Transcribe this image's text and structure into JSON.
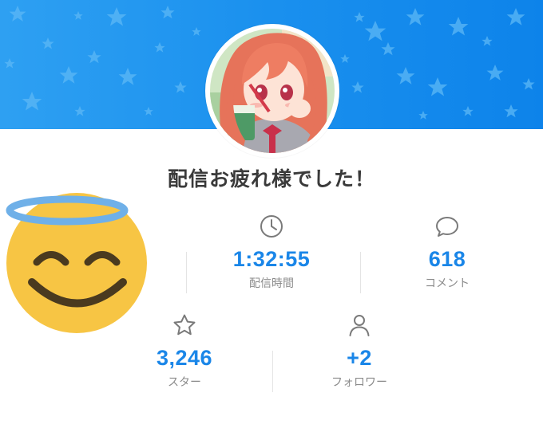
{
  "title": "配信お疲れ様でした！",
  "colors": {
    "banner": "#1a90ee",
    "accent": "#1a86e8",
    "label": "#8b8b8b",
    "emoji_face": "#f7c544",
    "halo": "#6fb0e8"
  },
  "stats": [
    {
      "icon": "clock-icon",
      "value": "1:32:55",
      "label": "配信時間"
    },
    {
      "icon": "comment-icon",
      "value": "618",
      "label": "コメント"
    },
    {
      "icon": "star-icon",
      "value": "3,246",
      "label": "スター"
    },
    {
      "icon": "person-icon",
      "value": "+2",
      "label": "フォロワー"
    }
  ]
}
